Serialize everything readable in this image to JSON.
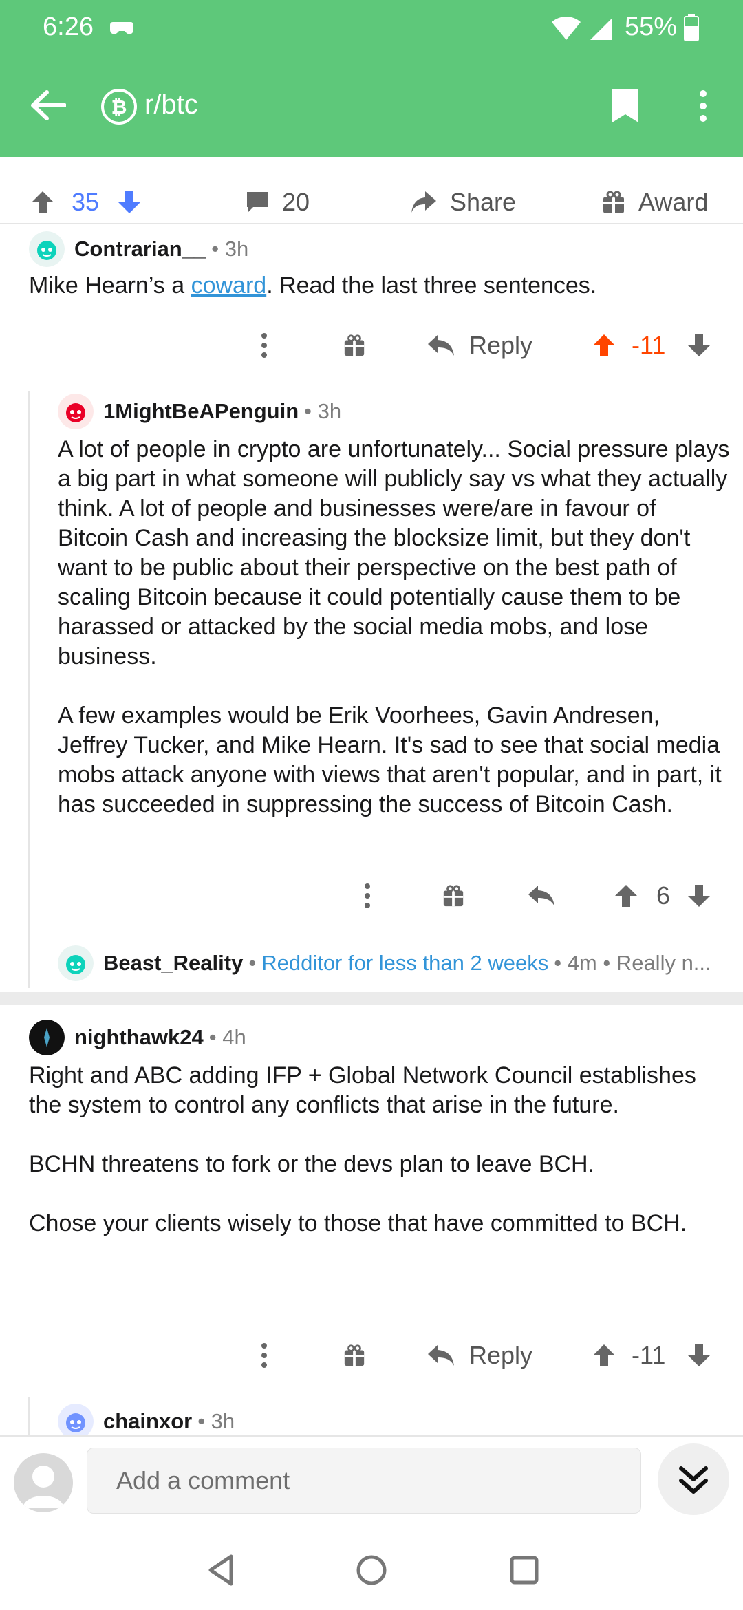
{
  "status_bar": {
    "time": "6:26",
    "battery": "55%",
    "icons": [
      "game-controller-icon",
      "wifi-icon",
      "cellular-signal-icon",
      "battery-icon"
    ]
  },
  "header": {
    "subreddit": "r/btc",
    "bg_color": "#5ec87a",
    "icons": [
      "back-arrow-icon",
      "bitcoin-icon",
      "bookmark-icon",
      "more-vertical-icon"
    ]
  },
  "post_actions": {
    "score": "35",
    "comments": "20",
    "share": "Share",
    "award": "Award"
  },
  "comments": [
    {
      "author": "Contrarian__",
      "meta": "• 3h",
      "text_before_link": "Mike Hearn’s a ",
      "link": "coward",
      "text_after_link": ". Read the last three sentences.",
      "reply_label": "Reply",
      "score": "-11"
    },
    {
      "author": "1MightBeAPenguin",
      "meta": "• 3h",
      "paragraphs": [
        "A lot of people in crypto are unfortunately... Social pressure plays a big part in what someone will publicly say vs what they actually think. A lot of people and businesses were/are in favour of Bitcoin Cash and increasing the blocksize limit, but they don't want to be public about their perspective on the best path of scaling Bitcoin because it could potentially cause them to be harassed or attacked by the social media mobs, and lose business.",
        "A few examples would be Erik Voorhees, Gavin Andresen, Jeffrey Tucker, and Mike Hearn. It's sad to see that social media mobs attack anyone with views that aren't popular, and in part, it has succeeded in suppressing the success of Bitcoin Cash."
      ],
      "score": "6"
    },
    {
      "author": "Beast_Reality",
      "flair": "Redditor for less than 2 weeks",
      "meta": "• 4m • Really n..."
    },
    {
      "author": "nighthawk24",
      "meta": "• 4h",
      "paragraphs": [
        "Right and ABC adding IFP + Global Network Council establishes the system to control any conflicts that arise in the future.",
        "BCHN threatens to fork or the devs plan to leave BCH.",
        "Chose your clients wisely to those that have committed to BCH."
      ],
      "reply_label": "Reply",
      "score": "-11"
    },
    {
      "author": "chainxor",
      "meta": "• 3h"
    }
  ],
  "bottom_bar": {
    "placeholder": "Add a comment"
  },
  "colors": {
    "accent_blue": "#4f7cff",
    "downvote_orange": "#ff4500",
    "link_blue": "#3294d8"
  }
}
